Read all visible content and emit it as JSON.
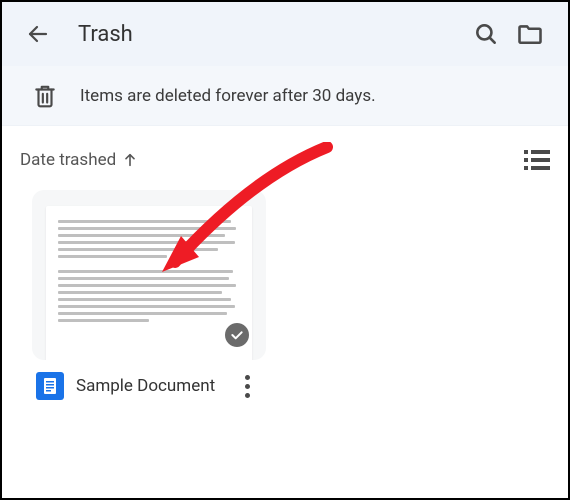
{
  "header": {
    "title": "Trash"
  },
  "notice": {
    "text": "Items are deleted forever after 30 days."
  },
  "sort": {
    "label": "Date trashed"
  },
  "file": {
    "name": "Sample Document"
  }
}
